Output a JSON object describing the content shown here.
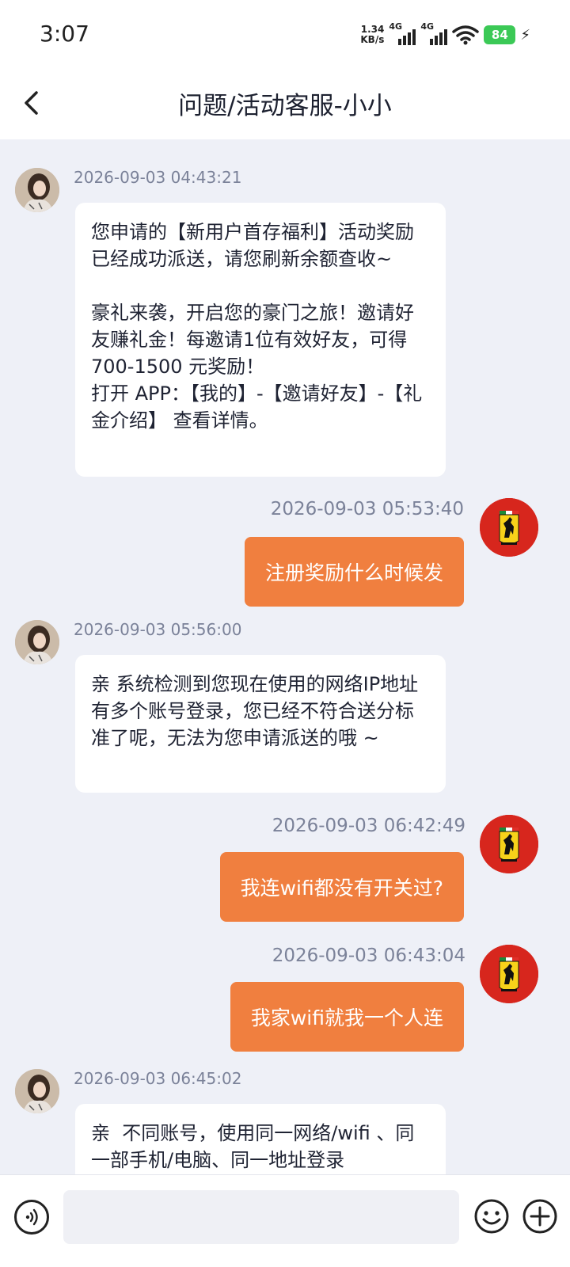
{
  "status_bar": {
    "time": "3:07",
    "net_speed_value": "1.34",
    "net_speed_unit": "KB/s",
    "signal1_label": "4G",
    "signal2_label": "4G",
    "battery": "84"
  },
  "header": {
    "title": "问题/活动客服-小小"
  },
  "messages": [
    {
      "side": "in",
      "time": "2026-09-03 04:43:21",
      "text": "您申请的【新用户首存福利】活动奖励已经成功派送，请您刷新余额查收~\n\n豪礼来袭，开启您的豪门之旅！邀请好友赚礼金！每邀请1位有效好友，可得 700-1500 元奖励！\n打开 APP：【我的】-【邀请好友】-【礼金介绍】 查看详情。"
    },
    {
      "side": "out",
      "time": "2026-09-03 05:53:40",
      "text": "注册奖励什么时候发"
    },
    {
      "side": "in",
      "time": "2026-09-03 05:56:00",
      "text": "亲 系统检测到您现在使用的网络IP地址有多个账号登录，您已经不符合送分标准了呢，无法为您申请派送的哦 ~"
    },
    {
      "side": "out",
      "time": "2026-09-03 06:42:49",
      "text": "我连wifi都没有开关过?"
    },
    {
      "side": "out",
      "time": "2026-09-03 06:43:04",
      "text": "我家wifi就我一个人连"
    },
    {
      "side": "in",
      "time": "2026-09-03 06:45:02",
      "text": "亲  不同账号，使用同一网络/wifi 、同一部手机/电脑、同一地址登录"
    }
  ],
  "input": {
    "placeholder": ""
  },
  "icons": {
    "back": "chevron-left-icon",
    "voice": "voice-icon",
    "emoji": "emoji-icon",
    "more": "plus-icon",
    "self_avatar": "ferrari-logo"
  },
  "colors": {
    "outgoing_bubble": "#f07f3f",
    "chat_background": "#eef0f7",
    "battery": "#3bc956"
  }
}
